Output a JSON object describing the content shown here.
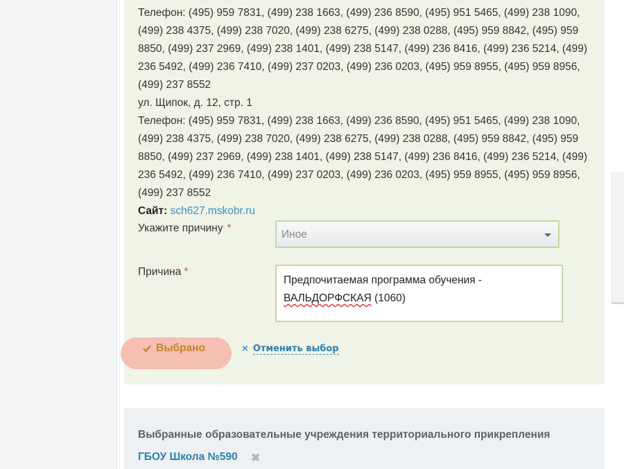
{
  "address_blocks": [
    {
      "phones": "Телефон: (495) 959 7831, (499) 238 1663, (499) 236 8590, (495) 951 5465, (499) 238 1090, (499) 238 4375, (499) 238 7020, (499) 238 6275, (499) 238 0288, (495) 959 8842, (495) 959 8850, (499) 237 2969, (499) 238 1401, (499) 238 5147, (499) 236 8416, (499) 236 5214, (499) 236 5492, (499) 236 7410, (499) 237 0203, (499) 236 0203, (495) 959 8955, (495) 959 8956, (499) 237 8552"
    },
    {
      "address": "ул. Щипок, д. 12, стр. 1",
      "phones": "Телефон: (495) 959 7831, (499) 238 1663, (499) 236 8590, (495) 951 5465, (499) 238 1090, (499) 238 4375, (499) 238 7020, (499) 238 6275, (499) 238 0288, (495) 959 8842, (495) 959 8850, (499) 237 2969, (499) 238 1401, (499) 238 5147, (499) 236 8416, (499) 236 5214, (499) 236 5492, (499) 236 7410, (499) 237 0203, (499) 236 0203, (495) 959 8955, (495) 959 8956, (499) 237 8552"
    }
  ],
  "site": {
    "label": "Сайт:",
    "url": "sch627.mskobr.ru"
  },
  "form": {
    "reason_select_label": "Укажите причину",
    "reason_select_value": "Иное",
    "reason_text_label": "Причина",
    "required_mark": "*",
    "reason_text_line1": "Предпочитаемая программа обучения -",
    "reason_text_word": "ВАЛЬДОРФСКАЯ",
    "reason_text_rest": "(1060)"
  },
  "actions": {
    "chosen_label": "Выбрано",
    "cancel_label": "Отменить выбор",
    "cancel_icon": "×"
  },
  "selected": {
    "title": "Выбранные образовательные учреждения территориального прикрепления",
    "school": "ГБОУ Школа №590",
    "remove_icon": "✖"
  },
  "colors": {
    "card_bg": "#f0f4e6",
    "accent_link": "#2d7eb0",
    "chosen_bg": "#f5bfb4",
    "chosen_text": "#c58327",
    "required": "#d9534f"
  }
}
